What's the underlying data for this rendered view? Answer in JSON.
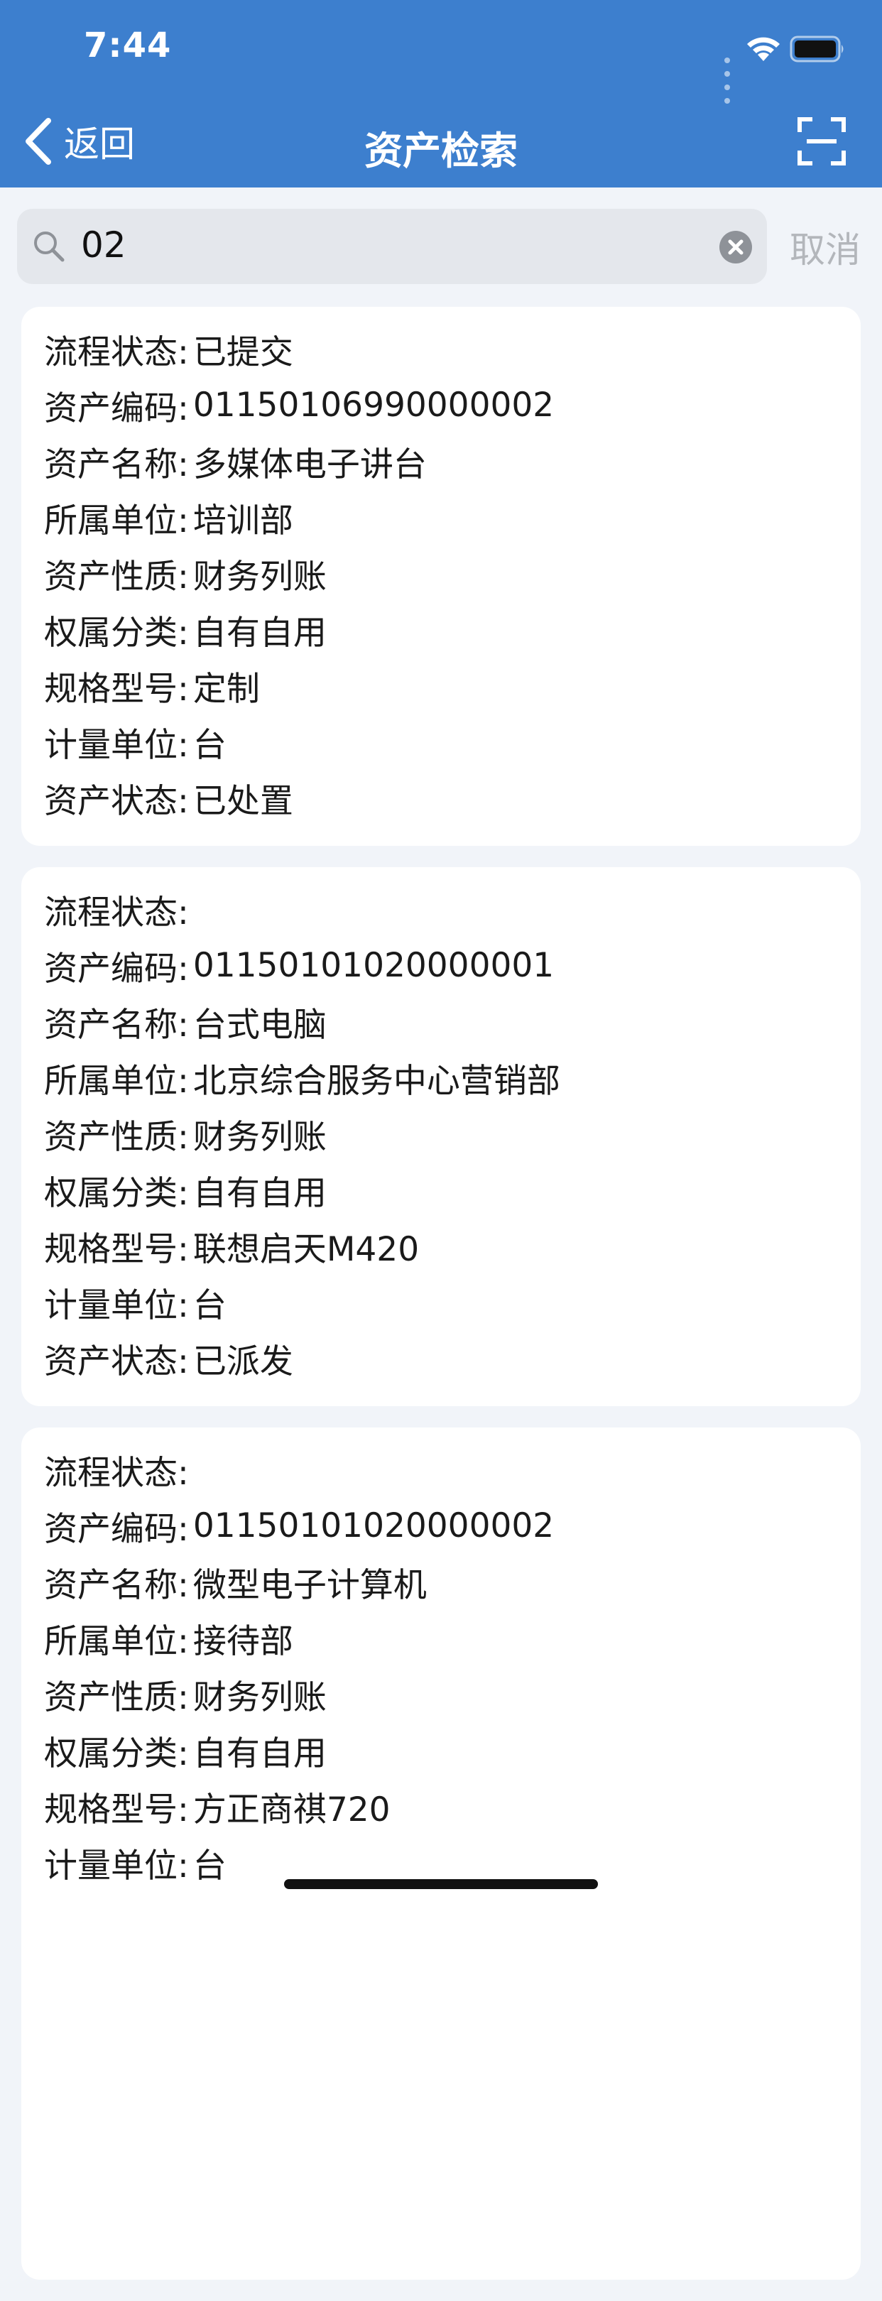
{
  "status_bar": {
    "time": "7:44"
  },
  "nav": {
    "back_label": "返回",
    "title": "资产检索",
    "scan_icon": "scan-icon"
  },
  "search": {
    "query": "02",
    "cancel_label": "取消"
  },
  "labels": {
    "process_status": "流程状态:",
    "asset_code": "资产编码:",
    "asset_name": "资产名称:",
    "unit": "所属单位:",
    "nature": "资产性质:",
    "ownership": "权属分类:",
    "model": "规格型号:",
    "measure": "计量单位:",
    "asset_status": "资产状态:"
  },
  "assets": [
    {
      "process_status": "已提交",
      "asset_code": "01150106990000002",
      "asset_name": "多媒体电子讲台",
      "unit": "培训部",
      "nature": "财务列账",
      "ownership": "自有自用",
      "model": "定制",
      "measure": "台",
      "asset_status": "已处置"
    },
    {
      "process_status": "",
      "asset_code": "01150101020000001",
      "asset_name": "台式电脑",
      "unit": "北京综合服务中心营销部",
      "nature": "财务列账",
      "ownership": "自有自用",
      "model": "联想启天M420",
      "measure": "台",
      "asset_status": "已派发"
    },
    {
      "process_status": "",
      "asset_code": "01150101020000002",
      "asset_name": "微型电子计算机",
      "unit": "接待部",
      "nature": "财务列账",
      "ownership": "自有自用",
      "model": "方正商祺720",
      "measure": "台"
    }
  ],
  "colors": {
    "header": "#3d7fce",
    "background": "#f1f4f9",
    "cancel": "#b3b6bb"
  }
}
